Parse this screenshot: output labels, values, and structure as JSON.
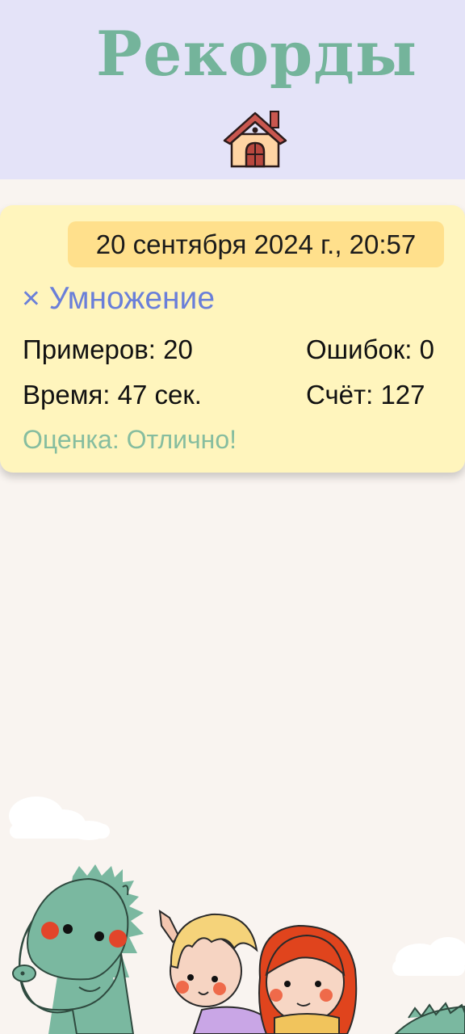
{
  "header": {
    "title": "Рекорды",
    "home_icon": "house-icon"
  },
  "record": {
    "date": "20 сентября 2024 г., 20:57",
    "operation": "× Умножение",
    "examples": "Примеров: 20",
    "errors": "Ошибок: 0",
    "time": "Время: 47 сек.",
    "score": "Счёт: 127",
    "grade": "Оценка: Отлично!"
  },
  "colors": {
    "header_bg": "#e4e3f8",
    "title": "#74b49b",
    "card_bg": "#fff5bd",
    "date_bg": "#ffe08c",
    "operation": "#6a7fd9",
    "grade": "#86bd9f"
  }
}
